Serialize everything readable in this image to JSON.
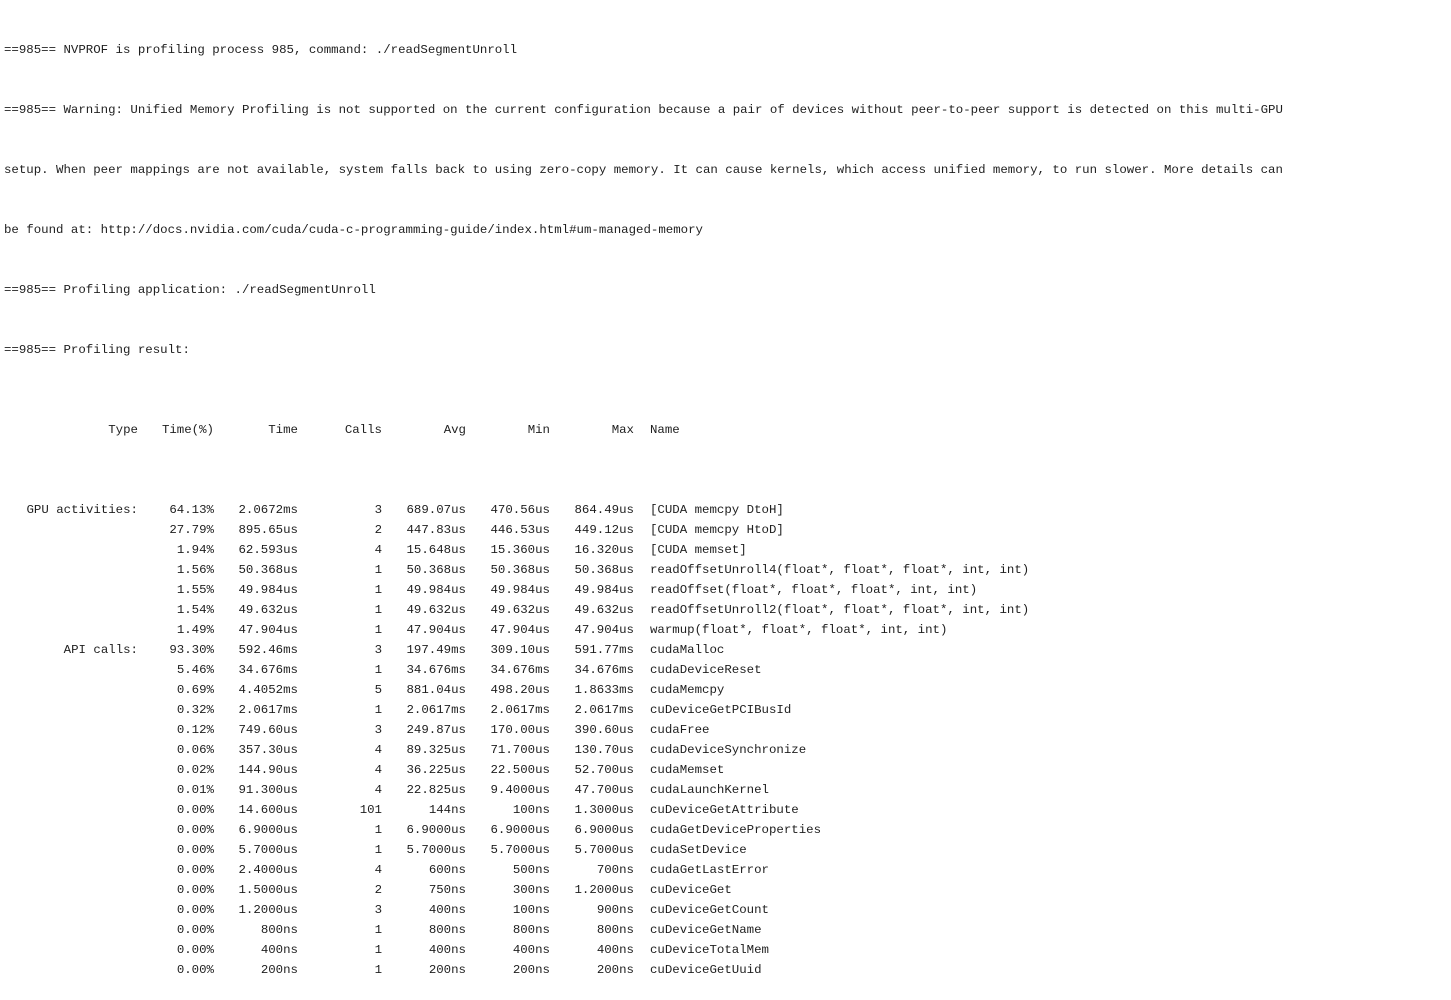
{
  "console": {
    "lines": [
      "==985== NVPROF is profiling process 985, command: ./readSegmentUnroll",
      "==985== Warning: Unified Memory Profiling is not supported on the current configuration because a pair of devices without peer-to-peer support is detected on this multi-GPU",
      "setup. When peer mappings are not available, system falls back to using zero-copy memory. It can cause kernels, which access unified memory, to run slower. More details can",
      "be found at: http://docs.nvidia.com/cuda/cuda-c-programming-guide/index.html#um-managed-memory",
      "==985== Profiling application: ./readSegmentUnroll",
      "==985== Profiling result:"
    ]
  },
  "table": {
    "headers": {
      "type": "Type",
      "pct": "Time(%)",
      "time": "Time",
      "calls": "Calls",
      "avg": "Avg",
      "min": "Min",
      "max": "Max",
      "name": "Name"
    },
    "rows": [
      {
        "type": "GPU activities:",
        "pct": "64.13%",
        "time": "2.0672ms",
        "calls": "3",
        "avg": "689.07us",
        "min": "470.56us",
        "max": "864.49us",
        "name": "[CUDA memcpy DtoH]"
      },
      {
        "type": "",
        "pct": "27.79%",
        "time": "895.65us",
        "calls": "2",
        "avg": "447.83us",
        "min": "446.53us",
        "max": "449.12us",
        "name": "[CUDA memcpy HtoD]"
      },
      {
        "type": "",
        "pct": "1.94%",
        "time": "62.593us",
        "calls": "4",
        "avg": "15.648us",
        "min": "15.360us",
        "max": "16.320us",
        "name": "[CUDA memset]"
      },
      {
        "type": "",
        "pct": "1.56%",
        "time": "50.368us",
        "calls": "1",
        "avg": "50.368us",
        "min": "50.368us",
        "max": "50.368us",
        "name": "readOffsetUnroll4(float*, float*, float*, int, int)"
      },
      {
        "type": "",
        "pct": "1.55%",
        "time": "49.984us",
        "calls": "1",
        "avg": "49.984us",
        "min": "49.984us",
        "max": "49.984us",
        "name": "readOffset(float*, float*, float*, int, int)"
      },
      {
        "type": "",
        "pct": "1.54%",
        "time": "49.632us",
        "calls": "1",
        "avg": "49.632us",
        "min": "49.632us",
        "max": "49.632us",
        "name": "readOffsetUnroll2(float*, float*, float*, int, int)"
      },
      {
        "type": "",
        "pct": "1.49%",
        "time": "47.904us",
        "calls": "1",
        "avg": "47.904us",
        "min": "47.904us",
        "max": "47.904us",
        "name": "warmup(float*, float*, float*, int, int)"
      },
      {
        "type": "API calls:",
        "pct": "93.30%",
        "time": "592.46ms",
        "calls": "3",
        "avg": "197.49ms",
        "min": "309.10us",
        "max": "591.77ms",
        "name": "cudaMalloc"
      },
      {
        "type": "",
        "pct": "5.46%",
        "time": "34.676ms",
        "calls": "1",
        "avg": "34.676ms",
        "min": "34.676ms",
        "max": "34.676ms",
        "name": "cudaDeviceReset"
      },
      {
        "type": "",
        "pct": "0.69%",
        "time": "4.4052ms",
        "calls": "5",
        "avg": "881.04us",
        "min": "498.20us",
        "max": "1.8633ms",
        "name": "cudaMemcpy"
      },
      {
        "type": "",
        "pct": "0.32%",
        "time": "2.0617ms",
        "calls": "1",
        "avg": "2.0617ms",
        "min": "2.0617ms",
        "max": "2.0617ms",
        "name": "cuDeviceGetPCIBusId"
      },
      {
        "type": "",
        "pct": "0.12%",
        "time": "749.60us",
        "calls": "3",
        "avg": "249.87us",
        "min": "170.00us",
        "max": "390.60us",
        "name": "cudaFree"
      },
      {
        "type": "",
        "pct": "0.06%",
        "time": "357.30us",
        "calls": "4",
        "avg": "89.325us",
        "min": "71.700us",
        "max": "130.70us",
        "name": "cudaDeviceSynchronize"
      },
      {
        "type": "",
        "pct": "0.02%",
        "time": "144.90us",
        "calls": "4",
        "avg": "36.225us",
        "min": "22.500us",
        "max": "52.700us",
        "name": "cudaMemset"
      },
      {
        "type": "",
        "pct": "0.01%",
        "time": "91.300us",
        "calls": "4",
        "avg": "22.825us",
        "min": "9.4000us",
        "max": "47.700us",
        "name": "cudaLaunchKernel"
      },
      {
        "type": "",
        "pct": "0.00%",
        "time": "14.600us",
        "calls": "101",
        "avg": "144ns",
        "min": "100ns",
        "max": "1.3000us",
        "name": "cuDeviceGetAttribute"
      },
      {
        "type": "",
        "pct": "0.00%",
        "time": "6.9000us",
        "calls": "1",
        "avg": "6.9000us",
        "min": "6.9000us",
        "max": "6.9000us",
        "name": "cudaGetDeviceProperties"
      },
      {
        "type": "",
        "pct": "0.00%",
        "time": "5.7000us",
        "calls": "1",
        "avg": "5.7000us",
        "min": "5.7000us",
        "max": "5.7000us",
        "name": "cudaSetDevice"
      },
      {
        "type": "",
        "pct": "0.00%",
        "time": "2.4000us",
        "calls": "4",
        "avg": "600ns",
        "min": "500ns",
        "max": "700ns",
        "name": "cudaGetLastError"
      },
      {
        "type": "",
        "pct": "0.00%",
        "time": "1.5000us",
        "calls": "2",
        "avg": "750ns",
        "min": "300ns",
        "max": "1.2000us",
        "name": "cuDeviceGet"
      },
      {
        "type": "",
        "pct": "0.00%",
        "time": "1.2000us",
        "calls": "3",
        "avg": "400ns",
        "min": "100ns",
        "max": "900ns",
        "name": "cuDeviceGetCount"
      },
      {
        "type": "",
        "pct": "0.00%",
        "time": "800ns",
        "calls": "1",
        "avg": "800ns",
        "min": "800ns",
        "max": "800ns",
        "name": "cuDeviceGetName"
      },
      {
        "type": "",
        "pct": "0.00%",
        "time": "400ns",
        "calls": "1",
        "avg": "400ns",
        "min": "400ns",
        "max": "400ns",
        "name": "cuDeviceTotalMem"
      },
      {
        "type": "",
        "pct": "0.00%",
        "time": "200ns",
        "calls": "1",
        "avg": "200ns",
        "min": "200ns",
        "max": "200ns",
        "name": "cuDeviceGetUuid"
      }
    ]
  }
}
